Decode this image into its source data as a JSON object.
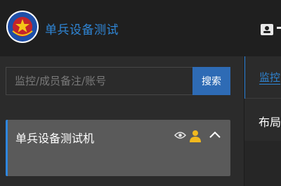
{
  "header": {
    "title": "单兵设备测试",
    "logo_icon": "police-emblem-icon",
    "user_icon": "user-card-icon"
  },
  "search": {
    "placeholder": "监控/成员备注/账号",
    "button_label": "搜索"
  },
  "device": {
    "name": "单兵设备测试机",
    "icons": [
      "eye-icon",
      "person-icon",
      "chevron-up-icon"
    ]
  },
  "right_panel": {
    "tab_label": "监控",
    "section_title": "布局"
  },
  "colors": {
    "accent": "#2f86d6",
    "button": "#2e6bb5",
    "person_icon": "#f2b91e",
    "header_bg": "#1f1f1f",
    "card_bg": "#5a5a5a"
  }
}
